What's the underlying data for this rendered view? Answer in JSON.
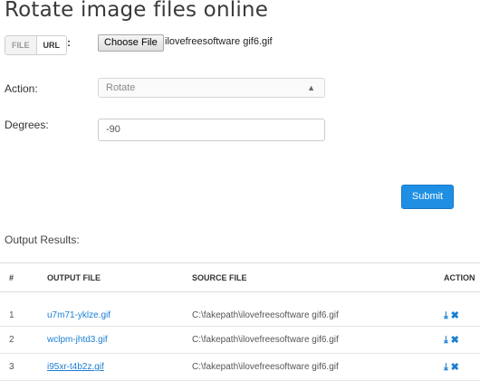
{
  "page": {
    "title": "Rotate image files online"
  },
  "source_toggle": {
    "file_label": "FILE",
    "url_label": "URL",
    "colon": ":"
  },
  "file_picker": {
    "button_label": "Choose File",
    "chosen_file": "ilovefreesoftware gif6.gif"
  },
  "action": {
    "label": "Action:",
    "selected": "Rotate"
  },
  "degrees": {
    "label": "Degrees:",
    "value": "-90"
  },
  "submit_label": "Submit",
  "output": {
    "label": "Output Results:",
    "columns": [
      "#",
      "OUTPUT FILE",
      "SOURCE FILE",
      "ACTION"
    ],
    "rows": [
      {
        "num": "1",
        "output_file": "u7m71-yklze.gif",
        "source_file": "C:\\fakepath\\ilovefreesoftware gif6.gif"
      },
      {
        "num": "2",
        "output_file": "wclpm-jhtd3.gif",
        "source_file": "C:\\fakepath\\ilovefreesoftware gif6.gif"
      },
      {
        "num": "3",
        "output_file": "i95xr-t4b2z.gif",
        "source_file": "C:\\fakepath\\ilovefreesoftware gif6.gif"
      }
    ]
  },
  "icons": {
    "download": "download-icon",
    "delete": "delete-icon"
  },
  "colors": {
    "accent": "#1f8fe3",
    "link": "#1a7fd4"
  }
}
